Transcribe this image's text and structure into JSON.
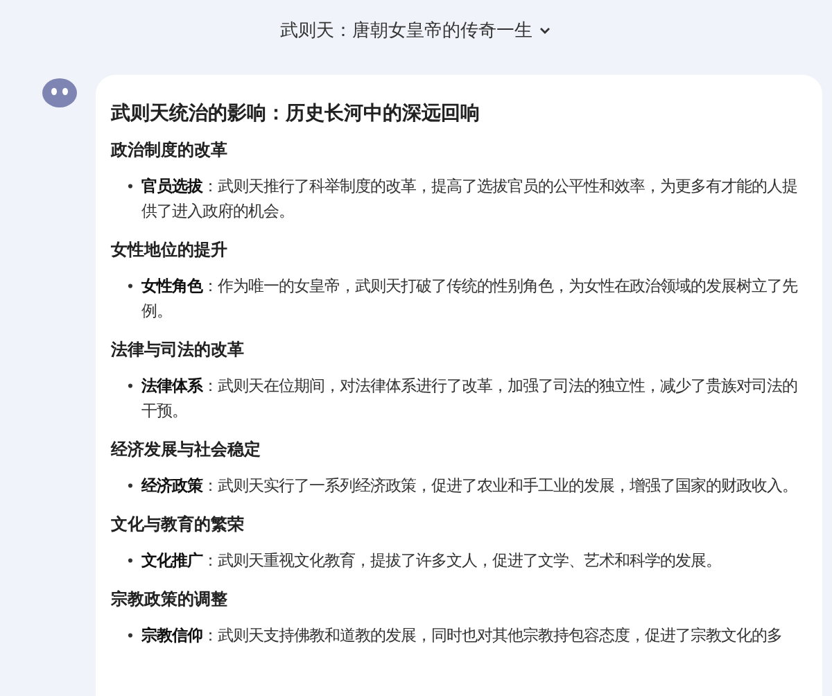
{
  "conversation_title": "武则天：唐朝女皇帝的传奇一生",
  "message": {
    "heading": "武则天统治的影响：历史长河中的深远回响",
    "sections": [
      {
        "title": "政治制度的改革",
        "marker": "•",
        "items": [
          "**官员选拔**：武则天推行了科举制度的改革，提高了选拔官员的公平性和效率，为更多有才能的人提供了进入政府的机会。"
        ]
      },
      {
        "title": "女性地位的提升",
        "marker": "•",
        "items": [
          "**女性角色**：作为唯一的女皇帝，武则天打破了传统的性别角色，为女性在政治领域的发展树立了先例。"
        ]
      },
      {
        "title": "法律与司法的改革",
        "marker": "•",
        "items": [
          "**法律体系**：武则天在位期间，对法律体系进行了改革，加强了司法的独立性，减少了贵族对司法的干预。"
        ]
      },
      {
        "title": "经济发展与社会稳定",
        "marker": "•",
        "items": [
          "**经济政策**：武则天实行了一系列经济政策，促进了农业和手工业的发展，增强了国家的财政收入。"
        ]
      },
      {
        "title": "文化与教育的繁荣",
        "marker": "•",
        "items": [
          "**文化推广**：武则天重视文化教育，提拔了许多文人，促进了文学、艺术和科学的发展。"
        ]
      },
      {
        "title": "宗教政策的调整",
        "marker": "•",
        "items": [
          "**宗教信仰**：武则天支持佛教和道教的发展，同时也对其他宗教持包容态度，促进了宗教文化的多"
        ]
      }
    ]
  }
}
